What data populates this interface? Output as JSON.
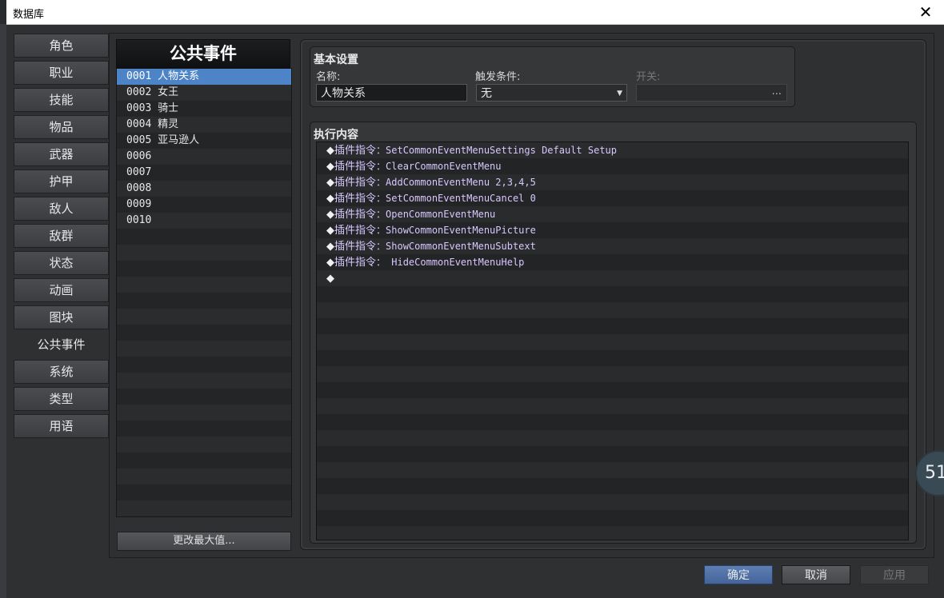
{
  "window": {
    "title": "数据库",
    "close_glyph": "✕"
  },
  "tabs": [
    "角色",
    "职业",
    "技能",
    "物品",
    "武器",
    "护甲",
    "敌人",
    "敌群",
    "状态",
    "动画",
    "图块",
    "公共事件",
    "系统",
    "类型",
    "用语"
  ],
  "active_tab_index": 11,
  "event_list": {
    "header": "公共事件",
    "items": [
      "0001 人物关系",
      "0002 女王",
      "0003 骑士",
      "0004 精灵",
      "0005 亚马逊人",
      "0006",
      "0007",
      "0008",
      "0009",
      "0010"
    ],
    "selected_index": 0,
    "change_max_label": "更改最大值..."
  },
  "basic": {
    "title": "基本设置",
    "name_label": "名称:",
    "name_value": "人物关系",
    "trigger_label": "触发条件:",
    "trigger_value": "无",
    "switch_label": "开关:",
    "switch_value": "",
    "switch_button": "..."
  },
  "exec": {
    "title": "执行内容",
    "lines": [
      {
        "prefix": "◆",
        "kw": "插件指令",
        "arg": "：SetCommonEventMenuSettings Default Setup"
      },
      {
        "prefix": "◆",
        "kw": "插件指令",
        "arg": "：ClearCommonEventMenu"
      },
      {
        "prefix": "◆",
        "kw": "插件指令",
        "arg": "：AddCommonEventMenu 2,3,4,5"
      },
      {
        "prefix": "◆",
        "kw": "插件指令",
        "arg": "：SetCommonEventMenuCancel 0"
      },
      {
        "prefix": "◆",
        "kw": "插件指令",
        "arg": "：OpenCommonEventMenu"
      },
      {
        "prefix": "◆",
        "kw": "插件指令",
        "arg": "：ShowCommonEventMenuPicture"
      },
      {
        "prefix": "◆",
        "kw": "插件指令",
        "arg": "：ShowCommonEventMenuSubtext"
      },
      {
        "prefix": "◆",
        "kw": "插件指令",
        "arg": "： HideCommonEventMenuHelp"
      },
      {
        "prefix": "◆",
        "kw": "",
        "arg": ""
      }
    ]
  },
  "buttons": {
    "ok": "确定",
    "cancel": "取消",
    "apply": "应用"
  },
  "badge_text": "51"
}
